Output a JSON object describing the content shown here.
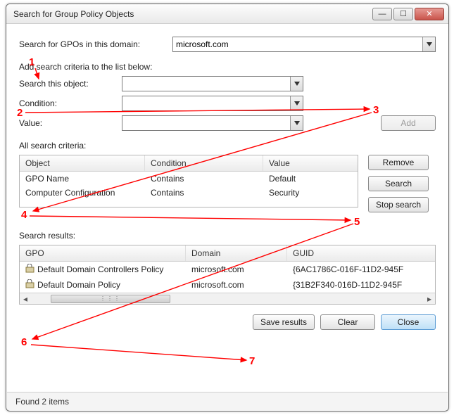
{
  "window": {
    "title": "Search for Group Policy Objects"
  },
  "domain": {
    "label": "Search for GPOs in this domain:",
    "value": "microsoft.com"
  },
  "instruction": "Add search criteria to the list below:",
  "fields": {
    "object_label": "Search this object:",
    "condition_label": "Condition:",
    "value_label": "Value:",
    "add_label": "Add"
  },
  "criteria": {
    "section_label": "All search criteria:",
    "headers": {
      "object": "Object",
      "condition": "Condition",
      "value": "Value"
    },
    "rows": [
      {
        "object": "GPO Name",
        "condition": "Contains",
        "value": "Default"
      },
      {
        "object": "Computer Configuration",
        "condition": "Contains",
        "value": "Security"
      }
    ]
  },
  "buttons": {
    "remove": "Remove",
    "search": "Search",
    "stop": "Stop search",
    "save": "Save results",
    "clear": "Clear",
    "close": "Close"
  },
  "results": {
    "section_label": "Search results:",
    "headers": {
      "gpo": "GPO",
      "domain": "Domain",
      "guid": "GUID"
    },
    "rows": [
      {
        "gpo": "Default Domain Controllers Policy",
        "domain": "microsoft.com",
        "guid": "{6AC1786C-016F-11D2-945F"
      },
      {
        "gpo": "Default Domain Policy",
        "domain": "microsoft.com",
        "guid": "{31B2F340-016D-11D2-945F"
      }
    ]
  },
  "status": "Found 2 items",
  "annotations": [
    "1",
    "2",
    "3",
    "4",
    "5",
    "6",
    "7"
  ]
}
